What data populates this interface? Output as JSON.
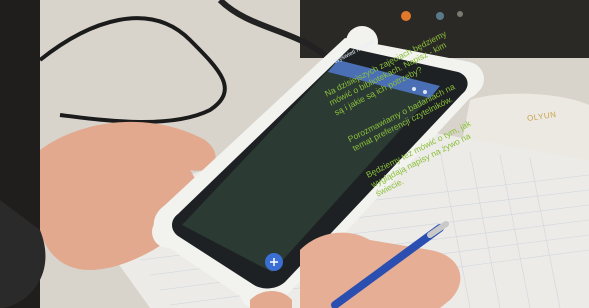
{
  "phone": {
    "app_title": "Wyświetl notatkę",
    "paragraphs": [
      "Na dzisiejszych zajęciach będziemy mówić o bibliotekach. Napisz - kim są i jakie są ich potrzeby?",
      "Porozmawiamy o badaniach na temat preferencji czytelników.",
      "Będziemy też mówić o tym, jak wyglądają napisy na żywo na świecie."
    ]
  },
  "device_brand": "OLYUN",
  "colors": {
    "screen_bg": "#2b3a33",
    "screen_text": "#8cbf3a",
    "app_bar": "#4a6fb5",
    "phone_case": "#f2f2ef",
    "fab": "#3b6fd4"
  }
}
